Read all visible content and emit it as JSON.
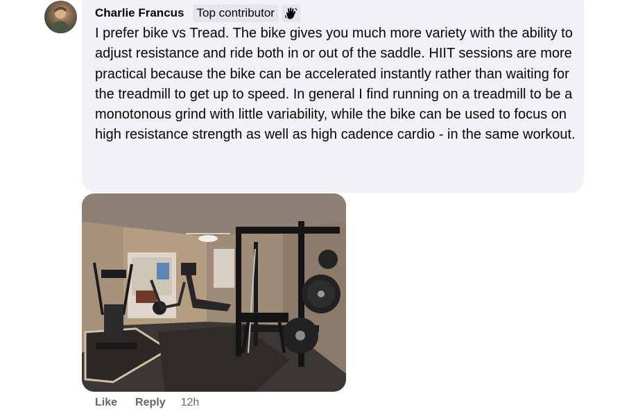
{
  "comment": {
    "author": "Charlie Francus",
    "badge": "Top contributor",
    "badge_icon": "waving-hand-icon",
    "text": "I prefer bike vs Tread. The bike gives you much more variety with the ability to adjust resistance and ride both in or out of the saddle. HIIT sessions are more practical because the bike can be accelerated instantly rather than waiting for the treadmill to get up to speed. In general I find running on a treadmill to be a monotonous grind with little variability, while the bike can be used to focus on high resistance strength as well as high cadence cardio - in the same workout.",
    "avatar_icon": "user-avatar",
    "attachment": "home-gym-photo"
  },
  "actions": {
    "like_label": "Like",
    "reply_label": "Reply",
    "timestamp": "12h"
  },
  "colors": {
    "bubble_bg": "#f0f2f5",
    "text": "#050505",
    "secondary_text": "#65676b",
    "badge_bg": "#e4e6eb"
  }
}
